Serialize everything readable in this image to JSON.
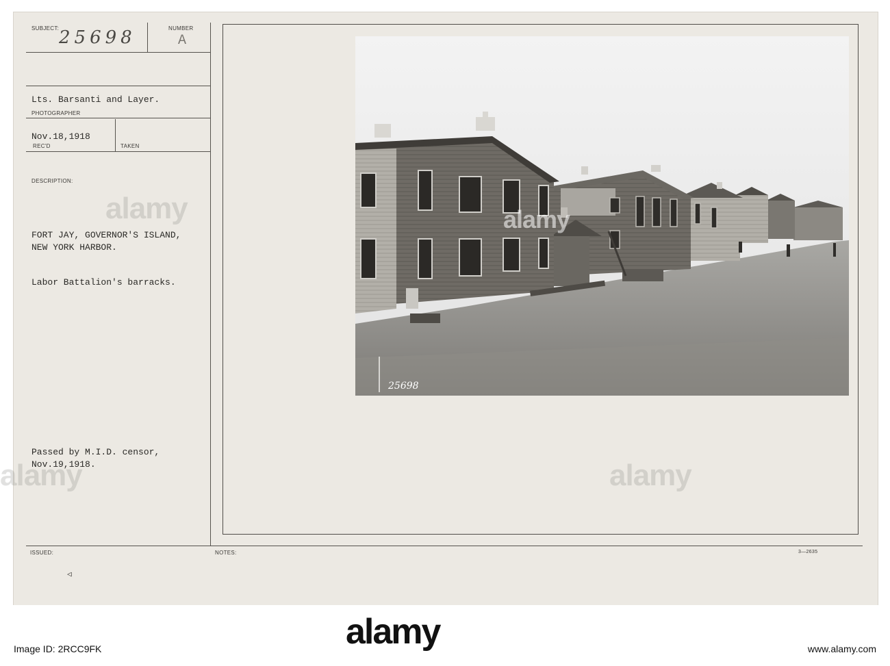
{
  "card": {
    "labels": {
      "subject": "SUBJECT:",
      "number": "NUMBER",
      "photographer": "PHOTOGRAPHER",
      "recd": "REC'D",
      "taken": "TAKEN",
      "description": "DESCRIPTION:",
      "issued": "ISSUED:",
      "notes": "NOTES:",
      "form_number": "3—2635"
    },
    "subject_number": "25698",
    "number_letter": "A",
    "photographer_name": "Lts. Barsanti and Layer.",
    "received_date": "Nov.18,1918",
    "location_line1": "FORT JAY, GOVERNOR'S ISLAND,",
    "location_line2": "NEW YORK HARBOR.",
    "caption": "Labor Battalion's barracks.",
    "censor_line1": "Passed by M.I.D. censor,",
    "censor_line2": "Nov.19,1918.",
    "issued_mark": "◁",
    "photo_negative_number": "25698"
  },
  "watermark_text": "alamy",
  "footer": {
    "logo": "alamy",
    "image_id": "Image ID: 2RCC9FK",
    "site": "www.alamy.com"
  },
  "colors": {
    "card": "#ece9e3",
    "ink": "#2a2926"
  }
}
